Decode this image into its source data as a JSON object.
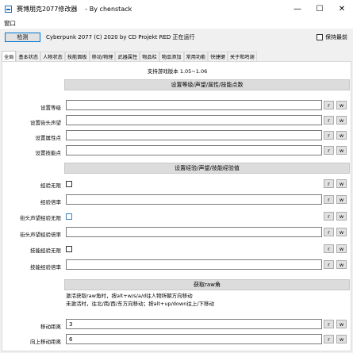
{
  "window": {
    "title": "赛博朋克2077修改器",
    "author": "- By chenstack",
    "controls": [
      "—",
      "☐",
      "✕"
    ]
  },
  "menu": {
    "items": [
      "窗口"
    ]
  },
  "toolbar": {
    "detect_label": "检测",
    "status": "Cyberpunk 2077 (C) 2020 by CD Projekt RED 正在运行",
    "keep_front_label": "保持最前"
  },
  "tabs": [
    "全局",
    "基本状态",
    "人物状态",
    "技能面板",
    "移动/物理",
    "武器属性",
    "物品栏",
    "物品添加",
    "常用功能",
    "快捷键",
    "关于和鸣谢"
  ],
  "panel": {
    "version": "支持游戏版本 1.05~1.06",
    "sections": [
      {
        "title": "设置等级/声望/属性/技能点数",
        "rows": [
          {
            "label": "设置等级",
            "value": ""
          },
          {
            "label": "设置街头声望",
            "value": ""
          },
          {
            "label": "设置属性点",
            "value": ""
          },
          {
            "label": "设置技能点",
            "value": ""
          }
        ]
      },
      {
        "title": "设置经验/声望/技能经验值",
        "rows": [
          {
            "label": "经验无限",
            "type": "checkbox"
          },
          {
            "label": "经验倍率",
            "value": ""
          },
          {
            "label": "街头声望经验无限",
            "type": "checkbox"
          },
          {
            "label": "街头声望经验倍率",
            "value": ""
          },
          {
            "label": "技能经验无限",
            "type": "checkbox"
          },
          {
            "label": "技能经验倍率",
            "value": ""
          }
        ]
      },
      {
        "title": "获取raw角",
        "desc_line1": "激活获取raw角时，按alt+w/s/a/d往人物所朝方向移动",
        "desc_line2": "未激活时，往北/南/西/东方向移动；按alt+up/down往上/下移动",
        "rows": [
          {
            "label": "移动距离",
            "value": "3"
          },
          {
            "label": "向上移动距离",
            "value": "6"
          }
        ]
      }
    ],
    "read_label": "r",
    "write_label": "w"
  }
}
